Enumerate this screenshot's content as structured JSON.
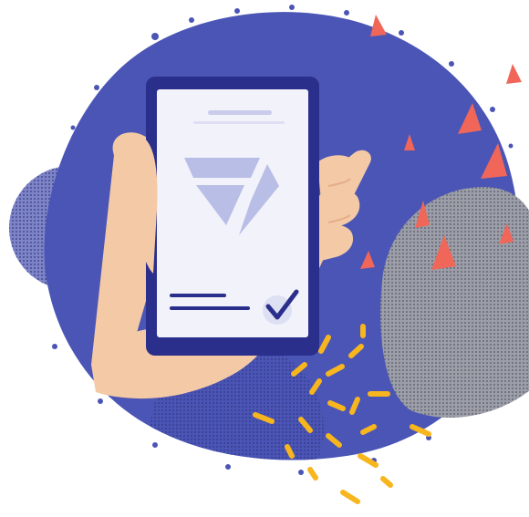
{
  "illustration": {
    "subject": "hand-holding-phone",
    "icons": [
      "logo-mark-icon",
      "checkmark-icon"
    ],
    "colors": {
      "background": "#ffffff",
      "blob": "#4B55B5",
      "blob_dark": "#3E47A6",
      "dot_texture": "#5A60A0",
      "dot_texture_gray": "#8A8C95",
      "phone_frame": "#2B2F8C",
      "phone_screen": "#F1F2FA",
      "logo": "#B9BEE6",
      "line_light": "#C9CCEB",
      "line_dark": "#2B2F8C",
      "check_circle": "#DDE0F3",
      "check": "#2B2F8C",
      "skin": "#F4C9A6",
      "skin_shadow": "#E5AE8A",
      "accent_triangle": "#F0675A",
      "confetti": "#F7B51E"
    }
  }
}
